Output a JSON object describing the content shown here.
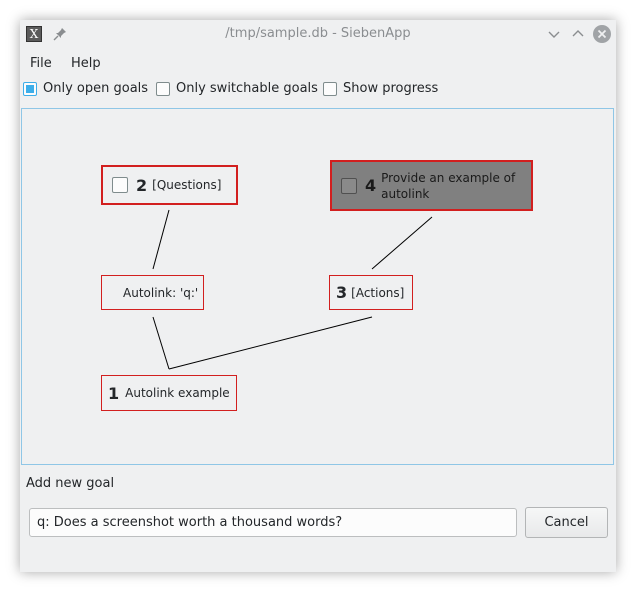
{
  "window": {
    "title": "/tmp/sample.db - SiebenApp",
    "app_icon": "X"
  },
  "menu": {
    "items": [
      {
        "label": "File"
      },
      {
        "label": "Help"
      }
    ]
  },
  "filters": [
    {
      "label": "Only open goals",
      "checked": true
    },
    {
      "label": "Only switchable goals",
      "checked": false
    },
    {
      "label": "Show progress",
      "checked": false
    }
  ],
  "goals": [
    {
      "id": "2",
      "label": "[Questions]",
      "has_checkbox": true,
      "selected": true,
      "closed": false
    },
    {
      "id": "4",
      "label": "Provide an example of autolink",
      "has_checkbox": true,
      "selected": true,
      "closed": true
    },
    {
      "id": "",
      "label": "Autolink: 'q:'",
      "has_checkbox": false,
      "selected": false,
      "closed": false
    },
    {
      "id": "3",
      "label": "[Actions]",
      "has_checkbox": false,
      "selected": false,
      "closed": false
    },
    {
      "id": "1",
      "label": "Autolink example",
      "has_checkbox": false,
      "selected": false,
      "closed": false
    }
  ],
  "new_goal": {
    "label": "Add new goal",
    "value": "q: Does a screenshot worth a thousand words?",
    "cancel_label": "Cancel"
  },
  "colors": {
    "goal_border": "#d21f1f",
    "closed_goal_fill": "#808080",
    "accent": "#3daee9"
  }
}
